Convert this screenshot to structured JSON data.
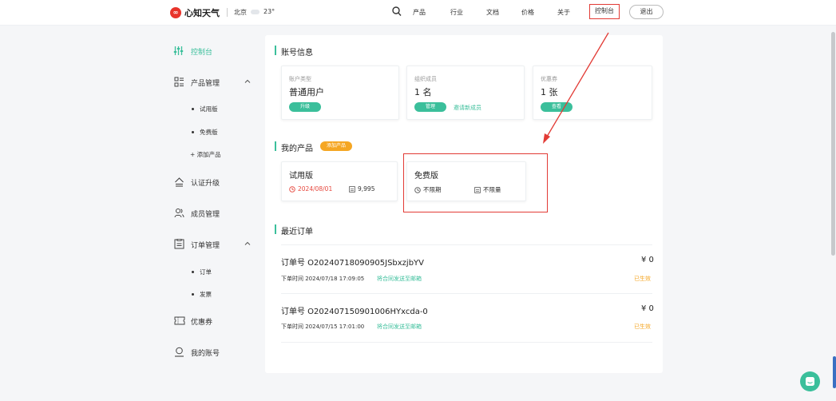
{
  "header": {
    "logo_text": "心知天气",
    "logo_mark": "∞",
    "city": "北京",
    "temperature": "23°",
    "nav": [
      "产品",
      "行业",
      "文档",
      "价格",
      "关于"
    ],
    "console": "控制台",
    "logout": "退出"
  },
  "sidebar": {
    "console": "控制台",
    "product_mgmt": "产品管理",
    "product_subs": [
      "试用版",
      "免费版"
    ],
    "add_product": "+ 添加产品",
    "cert_upgrade": "认证升级",
    "member_mgmt": "成员管理",
    "order_mgmt": "订单管理",
    "order_subs": [
      "订单",
      "发票"
    ],
    "coupons": "优惠券",
    "my_account": "我的账号"
  },
  "account": {
    "title": "账号信息",
    "cards": [
      {
        "label": "账户类型",
        "value": "普通用户",
        "button": "升级"
      },
      {
        "label": "组织成员",
        "value": "1 名",
        "button": "管理",
        "link": "邀请新成员"
      },
      {
        "label": "优惠券",
        "value": "1 张",
        "button": "查看"
      }
    ]
  },
  "products": {
    "title": "我的产品",
    "add_badge": "添加产品",
    "items": [
      {
        "name": "试用版",
        "expiry": "2024/08/01",
        "quota": "9,995"
      },
      {
        "name": "免费版",
        "expiry": "不限期",
        "quota": "不限量"
      }
    ]
  },
  "orders": {
    "title": "最近订单",
    "items": [
      {
        "number": "订单号 O20240718090905JSbxzjbYV",
        "amount": "¥ 0",
        "time": "下单时间 2024/07/18 17:09:05",
        "mail": "将合同发送至邮箱",
        "status": "已生效"
      },
      {
        "number": "订单号 O202407150901006HYxcda-0",
        "amount": "¥ 0",
        "time": "下单时间 2024/07/15 17:01:00",
        "mail": "将合同发送至邮箱",
        "status": "已生效"
      }
    ]
  },
  "colors": {
    "accent": "#3bbf9b",
    "annotation": "#e23b35",
    "badge": "#f5a623",
    "date_red": "#e6473d"
  }
}
